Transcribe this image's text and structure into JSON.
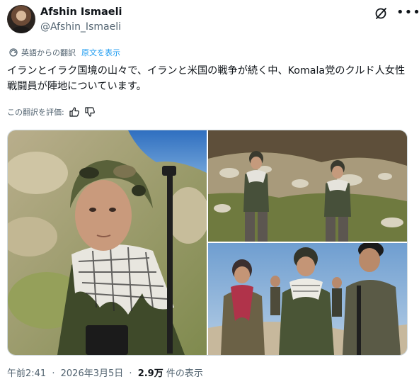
{
  "author": {
    "name": "Afshin Ismaeli",
    "handle": "@Afshin_Ismaeli"
  },
  "translation": {
    "label": "英語からの翻訳",
    "show_original": "原文を表示",
    "rate_prompt": "この翻訳を評価:"
  },
  "post": {
    "text": "イランとイラク国境の山々で、イランと米国の戦争が続く中、Komala党のクルド人女性戦闘員が陣地についています。"
  },
  "media": {
    "photo_count": 3
  },
  "footer": {
    "time": "午前2:41",
    "separator": "·",
    "date": "2026年3月5日",
    "views_count": "2.9万",
    "views_label": "件の表示"
  },
  "colors": {
    "text_primary": "#0f1419",
    "text_secondary": "#536471",
    "link": "#1d9bf0",
    "border": "#cfd9de"
  },
  "icons": [
    "grok-icon",
    "more-icon",
    "translate-icon",
    "thumbs-up-icon",
    "thumbs-down-icon"
  ]
}
